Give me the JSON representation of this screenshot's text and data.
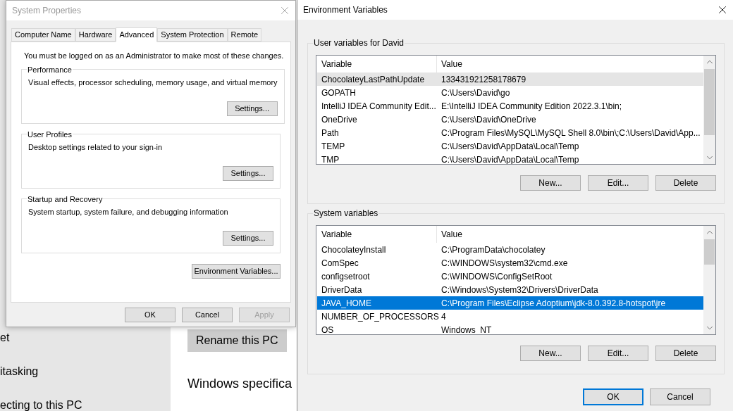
{
  "background_app": {
    "sidebar_items": [
      "et",
      "itasking",
      "ecting to this PC"
    ],
    "rename_button": "Rename this PC",
    "section_heading": "Windows specifica"
  },
  "system_properties": {
    "title": "System Properties",
    "active": false,
    "tabs": [
      {
        "label": "Computer Name",
        "selected": false
      },
      {
        "label": "Hardware",
        "selected": false
      },
      {
        "label": "Advanced",
        "selected": true
      },
      {
        "label": "System Protection",
        "selected": false
      },
      {
        "label": "Remote",
        "selected": false
      }
    ],
    "notice": "You must be logged on as an Administrator to make most of these changes.",
    "groups": [
      {
        "title": "Performance",
        "description": "Visual effects, processor scheduling, memory usage, and virtual memory",
        "button": "Settings..."
      },
      {
        "title": "User Profiles",
        "description": "Desktop settings related to your sign-in",
        "button": "Settings..."
      },
      {
        "title": "Startup and Recovery",
        "description": "System startup, system failure, and debugging information",
        "button": "Settings..."
      }
    ],
    "env_button": "Environment Variables...",
    "buttons": [
      {
        "label": "OK",
        "disabled": false
      },
      {
        "label": "Cancel",
        "disabled": false
      },
      {
        "label": "Apply",
        "disabled": true
      }
    ]
  },
  "environment_variables": {
    "title": "Environment Variables",
    "active": true,
    "sections": [
      {
        "title": "User variables for David",
        "focused": false,
        "columns": [
          "Variable",
          "Value"
        ],
        "rows": [
          {
            "variable": "ChocolateyLastPathUpdate",
            "value": "133431921258178679",
            "selected": true
          },
          {
            "variable": "GOPATH",
            "value": "C:\\Users\\David\\go",
            "selected": false
          },
          {
            "variable": "IntelliJ IDEA Community Edit...",
            "value": "E:\\IntelliJ IDEA Community Edition 2022.3.1\\bin;",
            "selected": false
          },
          {
            "variable": "OneDrive",
            "value": "C:\\Users\\David\\OneDrive",
            "selected": false
          },
          {
            "variable": "Path",
            "value": "C:\\Program Files\\MySQL\\MySQL Shell 8.0\\bin\\;C:\\Users\\David\\App...",
            "selected": false
          },
          {
            "variable": "TEMP",
            "value": "C:\\Users\\David\\AppData\\Local\\Temp",
            "selected": false
          },
          {
            "variable": "TMP",
            "value": "C:\\Users\\David\\AppData\\Local\\Temp",
            "selected": false
          }
        ],
        "buttons": [
          "New...",
          "Edit...",
          "Delete"
        ]
      },
      {
        "title": "System variables",
        "focused": true,
        "columns": [
          "Variable",
          "Value"
        ],
        "rows": [
          {
            "variable": "ChocolateyInstall",
            "value": "C:\\ProgramData\\chocolatey",
            "selected": false
          },
          {
            "variable": "ComSpec",
            "value": "C:\\WINDOWS\\system32\\cmd.exe",
            "selected": false
          },
          {
            "variable": "configsetroot",
            "value": "C:\\WINDOWS\\ConfigSetRoot",
            "selected": false
          },
          {
            "variable": "DriverData",
            "value": "C:\\Windows\\System32\\Drivers\\DriverData",
            "selected": false
          },
          {
            "variable": "JAVA_HOME",
            "value": "C:\\Program Files\\Eclipse Adoptium\\jdk-8.0.392.8-hotspot\\jre",
            "selected": true
          },
          {
            "variable": "NUMBER_OF_PROCESSORS",
            "value": "4",
            "selected": false
          },
          {
            "variable": "OS",
            "value": "Windows_NT",
            "selected": false
          }
        ],
        "buttons": [
          "New...",
          "Edit...",
          "Delete"
        ]
      }
    ],
    "buttons": [
      {
        "label": "OK",
        "default": true
      },
      {
        "label": "Cancel",
        "default": false
      }
    ]
  }
}
